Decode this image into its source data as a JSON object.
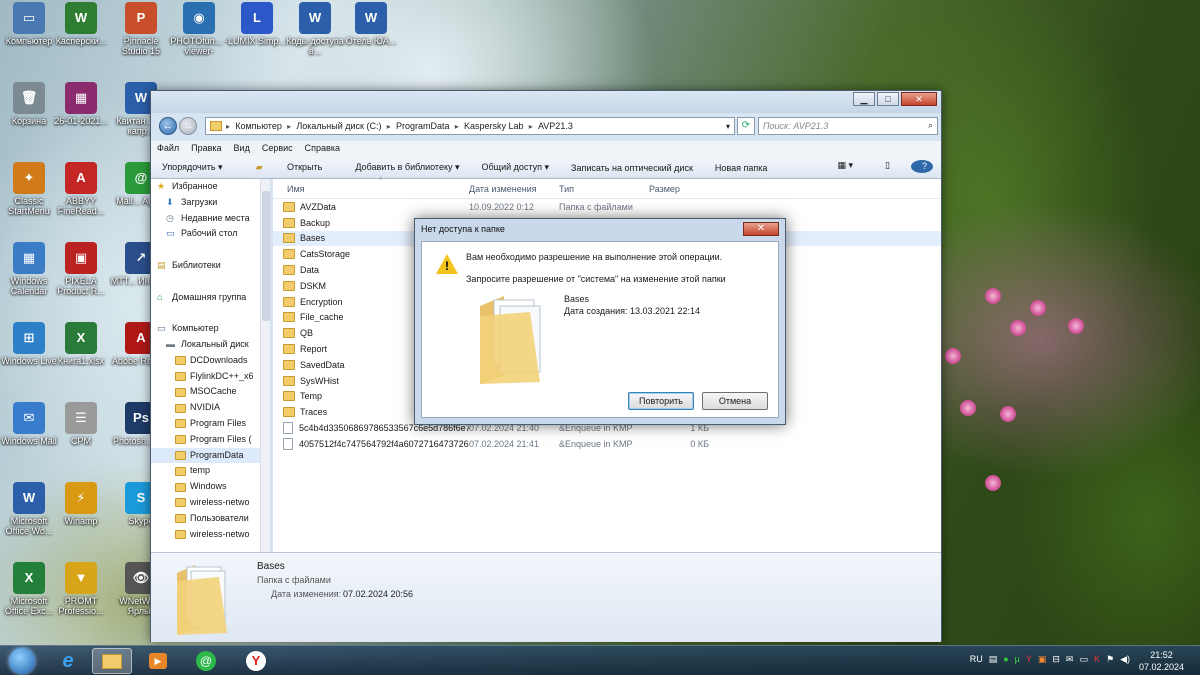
{
  "desktop": {
    "icons": [
      {
        "label": "Компьютер",
        "color": "#4a78b0",
        "glyph": "▭"
      },
      {
        "label": "Касперски...",
        "color": "#2f7d33",
        "glyph": "W"
      },
      {
        "label": "Pinnacle Studio 15",
        "color": "#c94f2a",
        "glyph": "P"
      },
      {
        "label": "PHOTOfun... -viewer-",
        "color": "#2a6fb0",
        "glyph": "◉"
      },
      {
        "label": "LUMIX Simp...",
        "color": "#2b57c8",
        "glyph": "L"
      },
      {
        "label": "Коды доступа в...",
        "color": "#2b5faa",
        "glyph": "W"
      },
      {
        "label": "Отель ЮА...",
        "color": "#2b5faa",
        "glyph": "W"
      },
      {
        "label": "Корзина",
        "color": "#7c8a94",
        "glyph": "🗑"
      },
      {
        "label": "26-01-2021...",
        "color": "#8a2b6e",
        "glyph": "▦"
      },
      {
        "label": "Квитан... по капр...",
        "color": "#2b5faa",
        "glyph": "W"
      },
      {
        "label": "Classic StartMenu",
        "color": "#d07a1a",
        "glyph": "✦"
      },
      {
        "label": "ABBYY FineRead...",
        "color": "#c42525",
        "glyph": "A"
      },
      {
        "label": "Mail... Agent",
        "color": "#2a9a3a",
        "glyph": "@"
      },
      {
        "label": "Windows Calendar",
        "color": "#3b7cc6",
        "glyph": "▦"
      },
      {
        "label": "PIXELA Product R...",
        "color": "#b22",
        "glyph": "▣"
      },
      {
        "label": "MTT... Интер...",
        "color": "#2b4f8c",
        "glyph": "↗"
      },
      {
        "label": "Windows Live",
        "color": "#2d7fc8",
        "glyph": "⊞"
      },
      {
        "label": "Книга1.xlsx",
        "color": "#2a7a3a",
        "glyph": "X"
      },
      {
        "label": "Adobe Reader",
        "color": "#b01818",
        "glyph": "A"
      },
      {
        "label": "Windows Mail",
        "color": "#3a7ccc",
        "glyph": "✉"
      },
      {
        "label": "CPM",
        "color": "#9a9a9a",
        "glyph": "☰"
      },
      {
        "label": "Photosh... CC",
        "color": "#1e3a66",
        "glyph": "Ps"
      },
      {
        "label": "Microsoft Office Wo...",
        "color": "#2b5faa",
        "glyph": "W"
      },
      {
        "label": "Winamp",
        "color": "#d89a12",
        "glyph": "⚡"
      },
      {
        "label": "Skype",
        "color": "#1b9ad9",
        "glyph": "S"
      },
      {
        "label": "Microsoft Office Exc...",
        "color": "#22803a",
        "glyph": "X"
      },
      {
        "label": "PROMT Professio...",
        "color": "#d8a418",
        "glyph": "▼"
      },
      {
        "label": "WNetW... - Ярлык",
        "color": "#555",
        "glyph": "👁"
      }
    ]
  },
  "window": {
    "title": "",
    "controls": {
      "minimize": "▁",
      "maximize": "□",
      "close": "✕"
    },
    "address": {
      "segments": [
        "Компьютер",
        "Локальный диск (C:)",
        "ProgramData",
        "Kaspersky Lab",
        "AVP21.3"
      ],
      "search_placeholder": "Поиск: AVP21.3"
    },
    "menu": [
      "Файл",
      "Правка",
      "Вид",
      "Сервис",
      "Справка"
    ],
    "toolbar": [
      "Упорядочить ▾",
      "Открыть",
      "Добавить в библиотеку ▾",
      "Общий доступ ▾",
      "Записать на оптический диск",
      "Новая папка"
    ],
    "nav": [
      {
        "label": "Избранное",
        "indent": 0,
        "kind": "star"
      },
      {
        "label": "Загрузки",
        "indent": 1,
        "kind": "dl"
      },
      {
        "label": "Недавние места",
        "indent": 1,
        "kind": "recent"
      },
      {
        "label": "Рабочий стол",
        "indent": 1,
        "kind": "desk"
      },
      {
        "label": "",
        "indent": 0,
        "kind": "gap"
      },
      {
        "label": "Библиотеки",
        "indent": 0,
        "kind": "lib"
      },
      {
        "label": "",
        "indent": 0,
        "kind": "gap"
      },
      {
        "label": "Домашняя группа",
        "indent": 0,
        "kind": "home"
      },
      {
        "label": "",
        "indent": 0,
        "kind": "gap"
      },
      {
        "label": "Компьютер",
        "indent": 0,
        "kind": "pc"
      },
      {
        "label": "Локальный диск",
        "indent": 1,
        "kind": "disk"
      },
      {
        "label": "DCDownloads",
        "indent": 2,
        "kind": "folder"
      },
      {
        "label": "FlylinkDC++_x6",
        "indent": 2,
        "kind": "folder"
      },
      {
        "label": "MSOCache",
        "indent": 2,
        "kind": "folder"
      },
      {
        "label": "NVIDIA",
        "indent": 2,
        "kind": "folder"
      },
      {
        "label": "Program Files",
        "indent": 2,
        "kind": "folder"
      },
      {
        "label": "Program Files (",
        "indent": 2,
        "kind": "folder"
      },
      {
        "label": "ProgramData",
        "indent": 2,
        "kind": "folder",
        "selected": true
      },
      {
        "label": "temp",
        "indent": 2,
        "kind": "folder"
      },
      {
        "label": "Windows",
        "indent": 2,
        "kind": "folder"
      },
      {
        "label": "wireless-netwo",
        "indent": 2,
        "kind": "folder"
      },
      {
        "label": "Пользователи",
        "indent": 2,
        "kind": "folder"
      },
      {
        "label": "wireless-netwo",
        "indent": 2,
        "kind": "folder"
      }
    ],
    "columns": {
      "name": "Имя",
      "date": "Дата изменения",
      "type": "Тип",
      "size": "Размер"
    },
    "files": [
      {
        "name": "AVZData",
        "date": "10.09.2022 0:12",
        "type": "Папка с файлами",
        "size": "",
        "kind": "folder"
      },
      {
        "name": "Backup",
        "date": "",
        "type": "",
        "size": "",
        "kind": "folder"
      },
      {
        "name": "Bases",
        "date": "",
        "type": "",
        "size": "",
        "kind": "folder",
        "selected": true
      },
      {
        "name": "CatsStorage",
        "date": "",
        "type": "",
        "size": "",
        "kind": "folder"
      },
      {
        "name": "Data",
        "date": "",
        "type": "",
        "size": "",
        "kind": "folder"
      },
      {
        "name": "DSKM",
        "date": "",
        "type": "",
        "size": "",
        "kind": "folder"
      },
      {
        "name": "Encryption",
        "date": "",
        "type": "",
        "size": "",
        "kind": "folder"
      },
      {
        "name": "File_cache",
        "date": "",
        "type": "",
        "size": "",
        "kind": "folder"
      },
      {
        "name": "QB",
        "date": "",
        "type": "",
        "size": "",
        "kind": "folder"
      },
      {
        "name": "Report",
        "date": "",
        "type": "",
        "size": "",
        "kind": "folder"
      },
      {
        "name": "SavedData",
        "date": "",
        "type": "",
        "size": "",
        "kind": "folder"
      },
      {
        "name": "SysWHist",
        "date": "",
        "type": "",
        "size": "",
        "kind": "folder"
      },
      {
        "name": "Temp",
        "date": "",
        "type": "",
        "size": "",
        "kind": "folder"
      },
      {
        "name": "Traces",
        "date": "",
        "type": "",
        "size": "",
        "kind": "folder"
      },
      {
        "name": "5c4b4d33506869786533567c6e5d786f6e76...",
        "date": "07.02.2024 21:40",
        "type": "&Enqueue in KMP",
        "size": "1 КБ",
        "kind": "file"
      },
      {
        "name": "4057512f4c747564792f4a6072716473726a...",
        "date": "07.02.2024 21:41",
        "type": "&Enqueue in KMP",
        "size": "0 КБ",
        "kind": "file"
      }
    ],
    "details": {
      "name": "Bases",
      "type": "Папка с файлами",
      "date_label": "Дата изменения:",
      "date": "07.02.2024 20:56"
    }
  },
  "dialog": {
    "title": "Нет доступа к папке",
    "close": "✕",
    "message": "Вам необходимо разрешение на выполнение этой операции.",
    "request": "Запросите разрешение от \"система\" на изменение этой папки",
    "item_name": "Bases",
    "item_created": "Дата создания: 13.03.2021 22:14",
    "retry": "Повторить",
    "cancel": "Отмена"
  },
  "taskbar": {
    "lang": "RU",
    "time": "21:52",
    "date": "07.02.2024"
  },
  "colors": {
    "accent": "#2f68a8",
    "warning": "#f4c21d",
    "close": "#c3452d"
  }
}
